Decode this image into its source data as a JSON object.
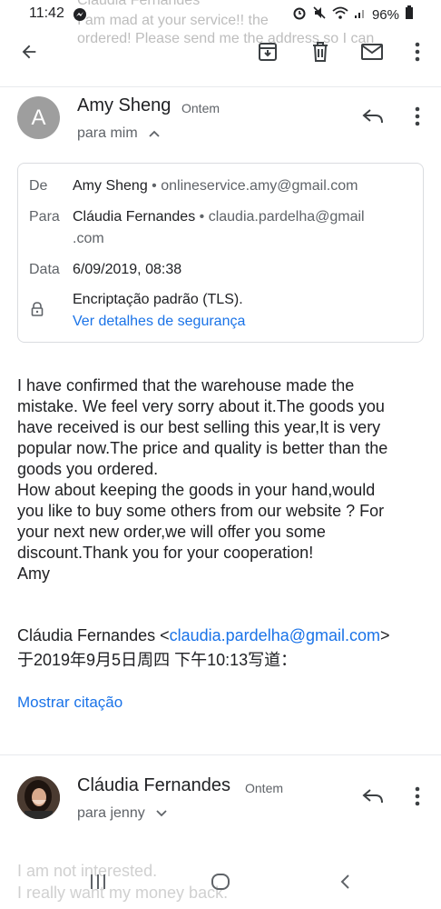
{
  "status_bar": {
    "time": "11:42",
    "battery": "96%",
    "ghost_top": "Cláudia Fernandes",
    "ghost_mid": "I am mad at your service!! the",
    "ghost_bottom": "ordered! Please send me the address so I can"
  },
  "toolbar": {
    "back_icon": "arrow-back-icon",
    "archive_icon": "archive-icon",
    "delete_icon": "trash-icon",
    "mark_unread_icon": "mail-icon",
    "more_icon": "more-vert-icon"
  },
  "message1": {
    "avatar_letter": "A",
    "avatar_color": "#9e9e9e",
    "sender": "Amy Sheng",
    "time": "Ontem",
    "recipient": "para mim",
    "details": {
      "from_label": "De",
      "from_name": "Amy Sheng",
      "from_email": "• onlineservice.amy@gmail.com",
      "to_label": "Para",
      "to_name": "Cláudia Fernandes",
      "to_email_part1": "• claudia.pardelha@gmail",
      "to_email_part2": ".com",
      "date_label": "Data",
      "date_value": "6/09/2019, 08:38",
      "security_text": "Encriptação padrão (TLS).",
      "security_link": "Ver detalhes de segurança"
    },
    "body_lines": [
      "I have confirmed that the warehouse made the",
      "mistake. We feel very sorry about it.The goods you",
      "have received is our best selling this year,It is very",
      "popular now.The price and quality is better than the",
      "goods you ordered.",
      "How about keeping the goods in your hand,would",
      "you like to buy some others from our website ? For",
      "your next new order,we will offer you some",
      "discount.Thank you for your cooperation!",
      "Amy"
    ],
    "quote_prefix": "Cláudia Fernandes <",
    "quote_email": "claudia.pardelha@gmail.com",
    "quote_suffix": ">",
    "quote_line2": "于2019年9月5日周四 下午10:13写道：",
    "show_quote": "Mostrar citação"
  },
  "message2": {
    "sender": "Cláudia Fernandes",
    "time": "Ontem",
    "recipient": "para jenny",
    "preview_line1": "I am not interested.",
    "preview_line2": "I really want my money back."
  },
  "colors": {
    "accent": "#1a73e8",
    "icon": "#5f6368"
  }
}
